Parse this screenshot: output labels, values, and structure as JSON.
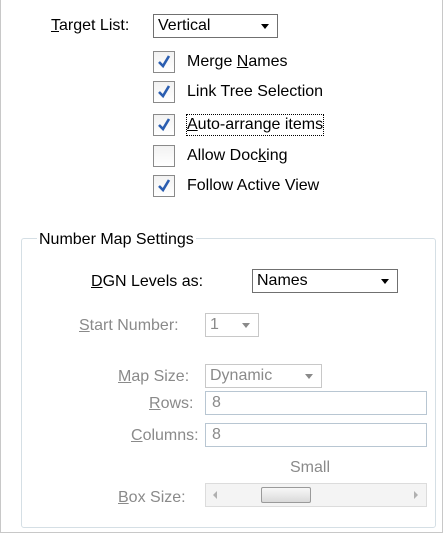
{
  "target_list": {
    "label_prefix": "",
    "label_mnemonic": "T",
    "label_rest": "arget List:",
    "value": "Vertical"
  },
  "options": [
    {
      "pre": "Merge ",
      "mn": "N",
      "post": "ames",
      "checked": true
    },
    {
      "pre": "Link Tree Selection",
      "mn": "",
      "post": "",
      "checked": true
    },
    {
      "pre": "",
      "mn": "A",
      "post": "uto-arrange items",
      "checked": true
    },
    {
      "pre": "Allow Doc",
      "mn": "k",
      "post": "ing",
      "checked": false
    },
    {
      "pre": "Follow Active View",
      "mn": "",
      "post": "",
      "checked": true
    }
  ],
  "number_map": {
    "title": "Number Map Settings",
    "dgn_levels": {
      "mn": "D",
      "rest": "GN Levels as:",
      "value": "Names"
    },
    "start_number": {
      "mn": "S",
      "rest": "tart Number:",
      "value": "1"
    },
    "map_size": {
      "mn": "M",
      "rest": "ap Size:",
      "value": "Dynamic"
    },
    "rows": {
      "mn": "R",
      "rest": "ows:",
      "value": "8"
    },
    "columns": {
      "mn": "C",
      "rest": "olumns:",
      "value": "8"
    },
    "box_size": {
      "mn": "B",
      "rest": "ox Size:",
      "level_text": "Small"
    }
  }
}
